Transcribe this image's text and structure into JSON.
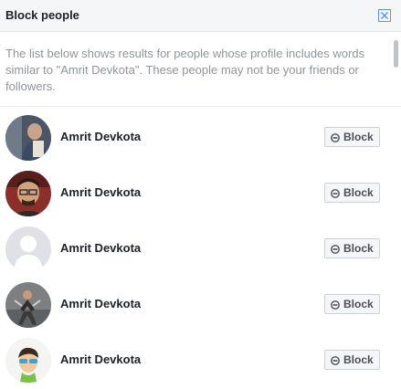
{
  "dialog": {
    "title": "Block people",
    "description": "The list below shows results for people whose profile includes words similar to \"Amrit Devkota\". These people may not be your friends or followers."
  },
  "people": [
    {
      "name": "Amrit Devkota",
      "button": "Block"
    },
    {
      "name": "Amrit Devkota",
      "button": "Block"
    },
    {
      "name": "Amrit Devkota",
      "button": "Block"
    },
    {
      "name": "Amrit Devkota",
      "button": "Block"
    },
    {
      "name": "Amrit Devkota",
      "button": "Block"
    }
  ],
  "colors": {
    "header_bg": "#f5f6f7",
    "muted_text": "#90949c",
    "button_border": "#ccd0d5",
    "close_icon": "#5890ff"
  }
}
